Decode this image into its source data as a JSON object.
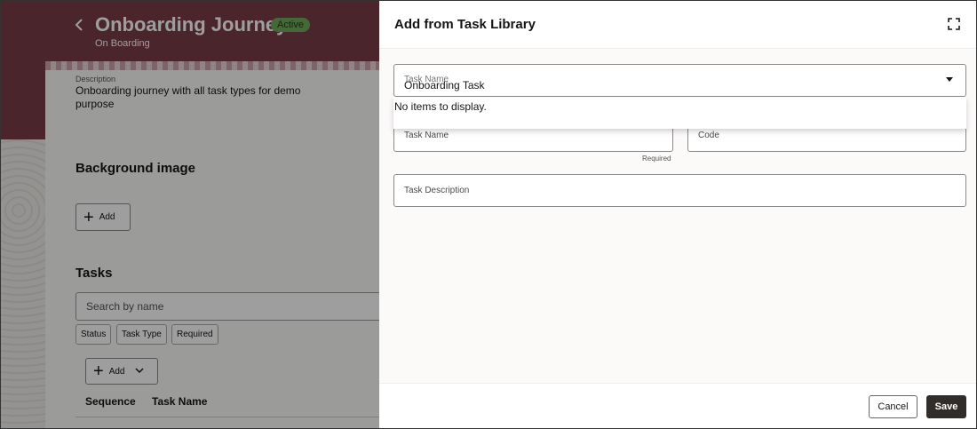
{
  "journey": {
    "title": "Onboarding Journey",
    "status": "Active",
    "subtitle": "On Boarding",
    "description_label": "Description",
    "description": "Onboarding journey with all task types for demo purpose"
  },
  "background_section": {
    "heading": "Background image",
    "add_label": "Add"
  },
  "tasks_section": {
    "heading": "Tasks",
    "search_placeholder": "Search by name",
    "filters": [
      "Status",
      "Task Type",
      "Required"
    ],
    "add_label": "Add",
    "columns": [
      "Sequence",
      "Task Name"
    ]
  },
  "drawer": {
    "title": "Add from Task Library",
    "library_field": {
      "label": "Task Name",
      "value": "Onboarding Task"
    },
    "dropdown_message": "No items to display.",
    "task_name_label": "Task Name",
    "task_name_hint": "Required",
    "code_label": "Code",
    "description_label": "Task Description",
    "cancel_label": "Cancel",
    "save_label": "Save"
  },
  "colors": {
    "banner": "#7a3c47",
    "badge": "#6fa85a",
    "primary_button": "#312d2a"
  }
}
